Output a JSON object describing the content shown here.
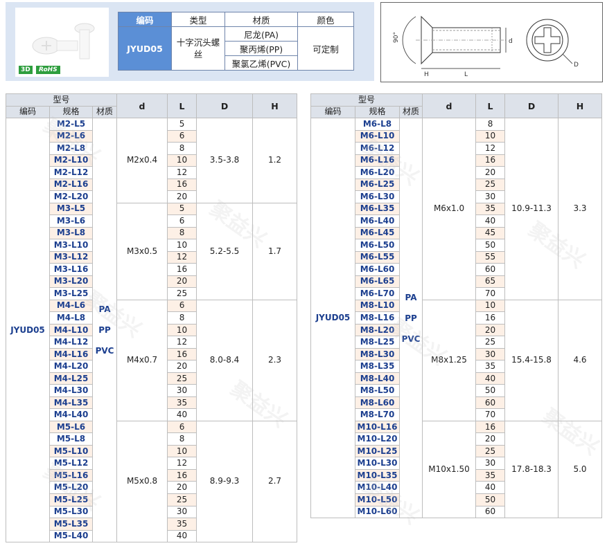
{
  "header": {
    "badge_3d": "3D",
    "badge_rohs": "RoHS",
    "col_code": "编码",
    "col_type": "类型",
    "col_material": "材质",
    "col_color": "颜色",
    "code": "JYUD05",
    "type": "十字沉头螺丝",
    "materials": [
      "尼龙(PA)",
      "聚丙烯(PP)",
      "聚氯乙烯(PVC)"
    ],
    "color": "可定制"
  },
  "drawing": {
    "angle": "90°",
    "label_H": "H",
    "label_L": "L",
    "label_d": "d",
    "label_D": "D"
  },
  "table_headers": {
    "model": "型号",
    "code": "编码",
    "spec": "规格",
    "material": "材质",
    "d": "d",
    "L": "L",
    "D": "D",
    "H": "H"
  },
  "left_table": {
    "code": "JYUD05",
    "materials": [
      "PA",
      "PP",
      "PVC"
    ],
    "groups": [
      {
        "d": "M2x0.4",
        "D": "3.5-3.8",
        "H": "1.2",
        "rows": [
          [
            "M2-L5",
            "5"
          ],
          [
            "M2-L6",
            "6"
          ],
          [
            "M2-L8",
            "8"
          ],
          [
            "M2-L10",
            "10"
          ],
          [
            "M2-L12",
            "12"
          ],
          [
            "M2-L16",
            "16"
          ],
          [
            "M2-L20",
            "20"
          ]
        ]
      },
      {
        "d": "M3x0.5",
        "D": "5.2-5.5",
        "H": "1.7",
        "rows": [
          [
            "M3-L5",
            "5"
          ],
          [
            "M3-L6",
            "6"
          ],
          [
            "M3-L8",
            "8"
          ],
          [
            "M3-L10",
            "10"
          ],
          [
            "M3-L12",
            "12"
          ],
          [
            "M3-L16",
            "16"
          ],
          [
            "M3-L20",
            "20"
          ],
          [
            "M3-L25",
            "25"
          ]
        ]
      },
      {
        "d": "M4x0.7",
        "D": "8.0-8.4",
        "H": "2.3",
        "rows": [
          [
            "M4-L6",
            "6"
          ],
          [
            "M4-L8",
            "8"
          ],
          [
            "M4-L10",
            "10"
          ],
          [
            "M4-L12",
            "12"
          ],
          [
            "M4-L16",
            "16"
          ],
          [
            "M4-L20",
            "20"
          ],
          [
            "M4-L25",
            "25"
          ],
          [
            "M4-L30",
            "30"
          ],
          [
            "M4-L35",
            "35"
          ],
          [
            "M4-L40",
            "40"
          ]
        ]
      },
      {
        "d": "M5x0.8",
        "D": "8.9-9.3",
        "H": "2.7",
        "rows": [
          [
            "M5-L6",
            "6"
          ],
          [
            "M5-L8",
            "8"
          ],
          [
            "M5-L10",
            "10"
          ],
          [
            "M5-L12",
            "12"
          ],
          [
            "M5-L16",
            "16"
          ],
          [
            "M5-L20",
            "20"
          ],
          [
            "M5-L25",
            "25"
          ],
          [
            "M5-L30",
            "30"
          ],
          [
            "M5-L35",
            "35"
          ],
          [
            "M5-L40",
            "40"
          ]
        ]
      }
    ]
  },
  "right_table": {
    "code": "JYUD05",
    "materials": [
      "PA",
      "PP",
      "PVC"
    ],
    "groups": [
      {
        "d": "M6x1.0",
        "D": "10.9-11.3",
        "H": "3.3",
        "rows": [
          [
            "M6-L8",
            "8"
          ],
          [
            "M6-L10",
            "10"
          ],
          [
            "M6-L12",
            "12"
          ],
          [
            "M6-L16",
            "16"
          ],
          [
            "M6-L20",
            "20"
          ],
          [
            "M6-L25",
            "25"
          ],
          [
            "M6-L30",
            "30"
          ],
          [
            "M6-L35",
            "35"
          ],
          [
            "M6-L40",
            "40"
          ],
          [
            "M6-L45",
            "45"
          ],
          [
            "M6-L50",
            "50"
          ],
          [
            "M6-L55",
            "55"
          ],
          [
            "M6-L60",
            "60"
          ],
          [
            "M6-L65",
            "65"
          ],
          [
            "M6-L70",
            "70"
          ]
        ]
      },
      {
        "d": "M8x1.25",
        "D": "15.4-15.8",
        "H": "4.6",
        "rows": [
          [
            "M8-L10",
            "10"
          ],
          [
            "M8-L16",
            "16"
          ],
          [
            "M8-L20",
            "20"
          ],
          [
            "M8-L25",
            "25"
          ],
          [
            "M8-L30",
            "30"
          ],
          [
            "M8-L35",
            "35"
          ],
          [
            "M8-L40",
            "40"
          ],
          [
            "M8-L50",
            "50"
          ],
          [
            "M8-L60",
            "60"
          ],
          [
            "M8-L70",
            "70"
          ]
        ]
      },
      {
        "d": "M10x1.50",
        "D": "17.8-18.3",
        "H": "5.0",
        "rows": [
          [
            "M10-L16",
            "16"
          ],
          [
            "M10-L20",
            "20"
          ],
          [
            "M10-L25",
            "25"
          ],
          [
            "M10-L30",
            "30"
          ],
          [
            "M10-L35",
            "35"
          ],
          [
            "M10-L40",
            "40"
          ],
          [
            "M10-L50",
            "50"
          ],
          [
            "M10-L60",
            "60"
          ]
        ]
      }
    ]
  },
  "watermark": "聚益兴"
}
